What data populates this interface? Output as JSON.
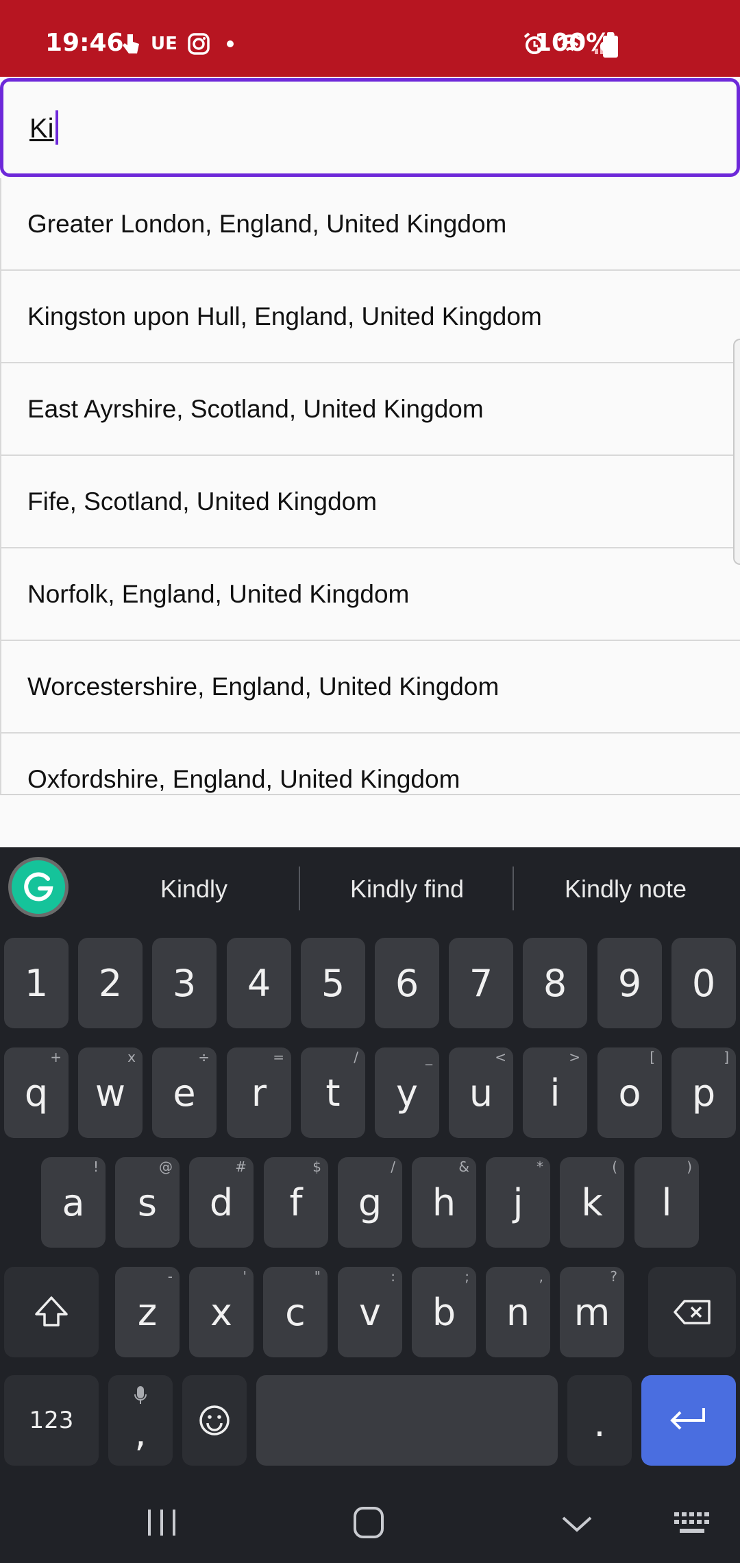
{
  "status_bar": {
    "time": "19:46",
    "carrier_label": "UE",
    "battery_percent": "100%",
    "icons": [
      "touch-icon",
      "instagram-icon",
      "dot-icon",
      "alarm-icon",
      "wifi-icon",
      "signal-icon",
      "battery-icon"
    ]
  },
  "search": {
    "value": "Ki"
  },
  "results": [
    "Greater London, England, United Kingdom",
    "Kingston upon Hull, England, United Kingdom",
    "East Ayrshire, Scotland, United Kingdom",
    "Fife, Scotland, United Kingdom",
    "Norfolk, England, United Kingdom",
    "Worcestershire, England, United Kingdom",
    "Oxfordshire, England, United Kingdom"
  ],
  "keyboard": {
    "suggestions": [
      "Kindly",
      "Kindly find",
      "Kindly note"
    ],
    "number_row": [
      "1",
      "2",
      "3",
      "4",
      "5",
      "6",
      "7",
      "8",
      "9",
      "0"
    ],
    "row1": [
      {
        "k": "q",
        "h": "+"
      },
      {
        "k": "w",
        "h": "x"
      },
      {
        "k": "e",
        "h": "÷"
      },
      {
        "k": "r",
        "h": "="
      },
      {
        "k": "t",
        "h": "/"
      },
      {
        "k": "y",
        "h": "_"
      },
      {
        "k": "u",
        "h": "<"
      },
      {
        "k": "i",
        "h": ">"
      },
      {
        "k": "o",
        "h": "["
      },
      {
        "k": "p",
        "h": "]"
      }
    ],
    "row2": [
      {
        "k": "a",
        "h": "!"
      },
      {
        "k": "s",
        "h": "@"
      },
      {
        "k": "d",
        "h": "#"
      },
      {
        "k": "f",
        "h": "$"
      },
      {
        "k": "g",
        "h": "/"
      },
      {
        "k": "h",
        "h": "&"
      },
      {
        "k": "j",
        "h": "*"
      },
      {
        "k": "k",
        "h": "("
      },
      {
        "k": "l",
        "h": ")"
      }
    ],
    "row3": [
      {
        "k": "z",
        "h": "-"
      },
      {
        "k": "x",
        "h": "'"
      },
      {
        "k": "c",
        "h": "\""
      },
      {
        "k": "v",
        "h": ":"
      },
      {
        "k": "b",
        "h": ";"
      },
      {
        "k": "n",
        "h": ","
      },
      {
        "k": "m",
        "h": "?"
      }
    ],
    "symbols_key": "123",
    "comma_key": ",",
    "period_key": "."
  },
  "colors": {
    "status_bar": "#b71521",
    "search_focus": "#6d28d9",
    "enter_key": "#4a6ee0",
    "keyboard_bg": "#202227",
    "grammarly": "#15c39a"
  }
}
